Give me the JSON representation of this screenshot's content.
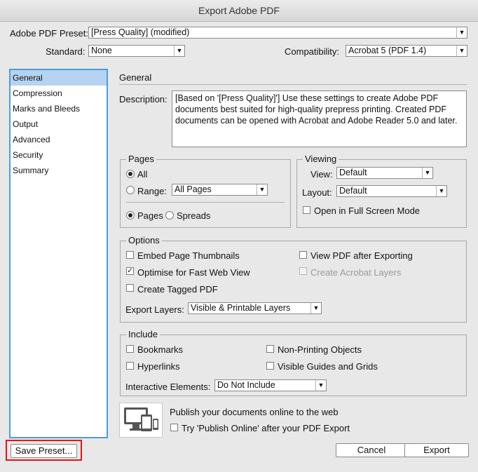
{
  "title": "Export Adobe PDF",
  "preset": {
    "label": "Adobe PDF Preset:",
    "value": "[Press Quality] (modified)"
  },
  "standard": {
    "label": "Standard:",
    "value": "None"
  },
  "compatibility": {
    "label": "Compatibility:",
    "value": "Acrobat 5 (PDF 1.4)"
  },
  "sidebar": {
    "items": [
      {
        "label": "General"
      },
      {
        "label": "Compression"
      },
      {
        "label": "Marks and Bleeds"
      },
      {
        "label": "Output"
      },
      {
        "label": "Advanced"
      },
      {
        "label": "Security"
      },
      {
        "label": "Summary"
      }
    ]
  },
  "general": {
    "heading": "General",
    "description_label": "Description:",
    "description": "[Based on '[Press Quality]'] Use these settings to create Adobe PDF documents best suited for high-quality prepress printing.  Created PDF documents can be opened with Acrobat and Adobe Reader 5.0 and later."
  },
  "pages": {
    "legend": "Pages",
    "all": "All",
    "range": "Range:",
    "range_value": "All Pages",
    "pages_opt": "Pages",
    "spreads_opt": "Spreads"
  },
  "viewing": {
    "legend": "Viewing",
    "view_label": "View:",
    "view_value": "Default",
    "layout_label": "Layout:",
    "layout_value": "Default",
    "fullscreen": "Open in Full Screen Mode"
  },
  "options": {
    "legend": "Options",
    "embed_thumbs": "Embed Page Thumbnails",
    "view_after": "View PDF after Exporting",
    "optimise": "Optimise for Fast Web View",
    "acrobat_layers": "Create Acrobat Layers",
    "tagged": "Create Tagged PDF",
    "export_layers_label": "Export Layers:",
    "export_layers_value": "Visible & Printable Layers",
    "check": "✓"
  },
  "include": {
    "legend": "Include",
    "bookmarks": "Bookmarks",
    "non_printing": "Non-Printing Objects",
    "hyperlinks": "Hyperlinks",
    "guides": "Visible Guides and Grids",
    "interactive_label": "Interactive Elements:",
    "interactive_value": "Do Not Include"
  },
  "publish": {
    "text": "Publish your documents online to the web",
    "try": "Try 'Publish Online' after your PDF Export",
    "icon": "devices-icon"
  },
  "buttons": {
    "save_preset": "Save Preset...",
    "cancel": "Cancel",
    "export": "Export"
  },
  "colors": {
    "accent": "#4aa0d6",
    "selection": "#b5d3f3",
    "highlight": "#e3141b"
  }
}
